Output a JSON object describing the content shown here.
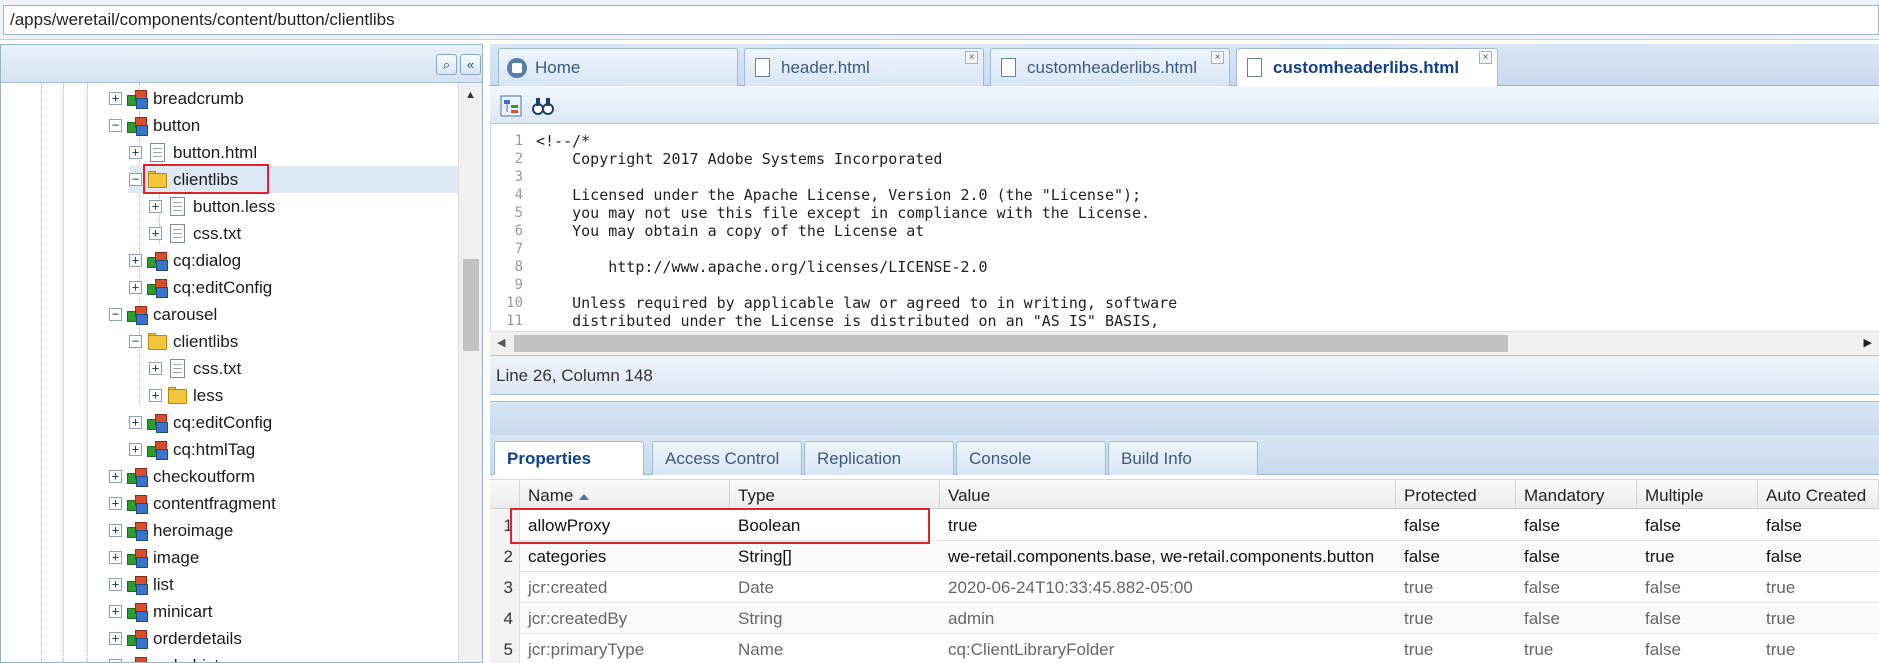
{
  "path": "/apps/weretail/components/content/button/clientlibs",
  "tree": {
    "nodes": [
      {
        "label": "breadcrumb",
        "icon": "component-icon",
        "expander": "+"
      },
      {
        "label": "button",
        "icon": "component-icon",
        "expander": "−"
      },
      {
        "label": "button.html",
        "icon": "file-icon",
        "expander": "+"
      },
      {
        "label": "clientlibs",
        "icon": "folder-icon",
        "expander": "−",
        "selected": true
      },
      {
        "label": "button.less",
        "icon": "file-icon",
        "expander": "+"
      },
      {
        "label": "css.txt",
        "icon": "file-icon",
        "expander": "+"
      },
      {
        "label": "cq:dialog",
        "icon": "component-icon",
        "expander": "+"
      },
      {
        "label": "cq:editConfig",
        "icon": "component-icon",
        "expander": "+"
      },
      {
        "label": "carousel",
        "icon": "component-icon",
        "expander": "−"
      },
      {
        "label": "clientlibs",
        "icon": "folder-icon",
        "expander": "−"
      },
      {
        "label": "css.txt",
        "icon": "file-icon",
        "expander": "+"
      },
      {
        "label": "less",
        "icon": "folder-icon",
        "expander": "+"
      },
      {
        "label": "cq:editConfig",
        "icon": "component-icon",
        "expander": "+"
      },
      {
        "label": "cq:htmlTag",
        "icon": "component-icon",
        "expander": "+"
      },
      {
        "label": "checkoutform",
        "icon": "component-icon",
        "expander": "+"
      },
      {
        "label": "contentfragment",
        "icon": "component-icon",
        "expander": "+"
      },
      {
        "label": "heroimage",
        "icon": "component-icon",
        "expander": "+"
      },
      {
        "label": "image",
        "icon": "component-icon",
        "expander": "+"
      },
      {
        "label": "list",
        "icon": "component-icon",
        "expander": "+"
      },
      {
        "label": "minicart",
        "icon": "component-icon",
        "expander": "+"
      },
      {
        "label": "orderdetails",
        "icon": "component-icon",
        "expander": "+"
      },
      {
        "label": "orderhistory",
        "icon": "component-icon",
        "expander": "+"
      }
    ]
  },
  "editor_tabs": [
    {
      "label": "Home",
      "icon": "home-icon",
      "closable": false,
      "active": false
    },
    {
      "label": "header.html",
      "icon": "document-icon",
      "closable": true,
      "active": false
    },
    {
      "label": "customheaderlibs.html",
      "icon": "document-icon",
      "closable": true,
      "active": false
    },
    {
      "label": "customheaderlibs.html",
      "icon": "document-icon",
      "closable": true,
      "active": true
    }
  ],
  "code": {
    "line_numbers": [
      "1",
      "2",
      "3",
      "4",
      "5",
      "6",
      "7",
      "8",
      "9",
      "10",
      "11"
    ],
    "lines": [
      "<!--/*",
      "    Copyright 2017 Adobe Systems Incorporated",
      "",
      "    Licensed under the Apache License, Version 2.0 (the \"License\");",
      "    you may not use this file except in compliance with the License.",
      "    You may obtain a copy of the License at",
      "",
      "        http://www.apache.org/licenses/LICENSE-2.0",
      "",
      "    Unless required by applicable law or agreed to in writing, software",
      "    distributed under the License is distributed on an \"AS IS\" BASIS,"
    ]
  },
  "status": "Line 26, Column 148",
  "props_tabs": [
    "Properties",
    "Access Control",
    "Replication",
    "Console",
    "Build Info"
  ],
  "grid": {
    "columns": [
      "Name",
      "Type",
      "Value",
      "Protected",
      "Mandatory",
      "Multiple",
      "Auto Created"
    ],
    "sorted_column": "Name",
    "rows": [
      {
        "n": "1",
        "name": "allowProxy",
        "type": "Boolean",
        "value": "true",
        "protected": "false",
        "mandatory": "false",
        "multiple": "false",
        "auto": "false"
      },
      {
        "n": "2",
        "name": "categories",
        "type": "String[]",
        "value": "we-retail.components.base, we-retail.components.button",
        "protected": "false",
        "mandatory": "false",
        "multiple": "true",
        "auto": "false"
      },
      {
        "n": "3",
        "name": "jcr:created",
        "type": "Date",
        "value": "2020-06-24T10:33:45.882-05:00",
        "protected": "true",
        "mandatory": "false",
        "multiple": "false",
        "auto": "true"
      },
      {
        "n": "4",
        "name": "jcr:createdBy",
        "type": "String",
        "value": "admin",
        "protected": "true",
        "mandatory": "false",
        "multiple": "false",
        "auto": "true"
      },
      {
        "n": "5",
        "name": "jcr:primaryType",
        "type": "Name",
        "value": "cq:ClientLibraryFolder",
        "protected": "true",
        "mandatory": "true",
        "multiple": "false",
        "auto": "true"
      }
    ]
  },
  "colors": {
    "accent": "#11418a",
    "highlight": "#e0242c",
    "selection": "#dde9f7"
  }
}
